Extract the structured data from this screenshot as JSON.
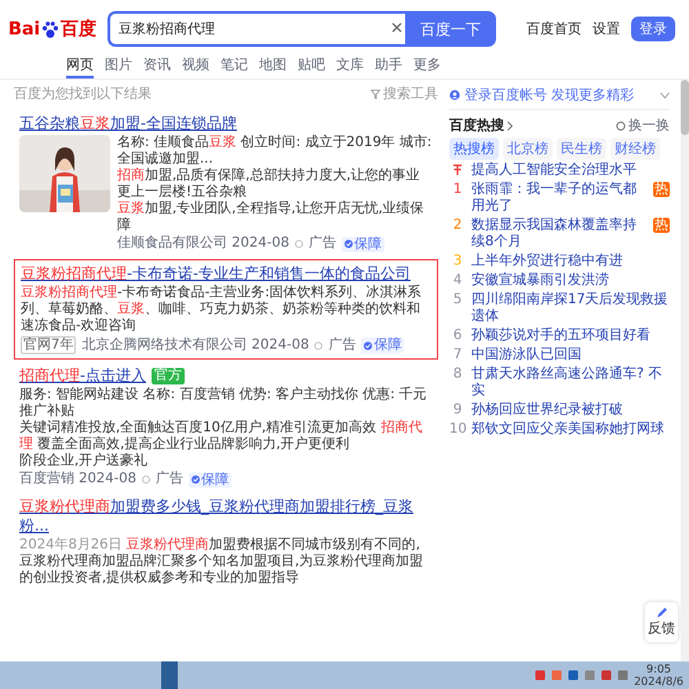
{
  "header": {
    "logo": {
      "left": "Bai",
      "right": "百度"
    },
    "search": {
      "value": "豆浆粉招商代理"
    },
    "button": "百度一下",
    "links": [
      "百度首页",
      "设置"
    ],
    "login": "登录"
  },
  "tabs": [
    {
      "label": "网页",
      "selected": true
    },
    {
      "label": "图片",
      "selected": false
    },
    {
      "label": "资讯",
      "selected": false
    },
    {
      "label": "视频",
      "selected": false
    },
    {
      "label": "笔记",
      "selected": false
    },
    {
      "label": "地图",
      "selected": false
    },
    {
      "label": "贴吧",
      "selected": false
    },
    {
      "label": "文库",
      "selected": false
    },
    {
      "label": "助手",
      "selected": false
    },
    {
      "label": "更多",
      "selected": false
    }
  ],
  "result_info": "百度为您找到以下结果",
  "tools": "搜索工具",
  "results": [
    {
      "kind": "ad",
      "framed": false,
      "picture": true,
      "title": [
        {
          "text": "五谷杂粮",
          "hit": false
        },
        {
          "text": "豆浆",
          "hit": true
        },
        {
          "text": "加盟-全国连锁品牌",
          "hit": false
        }
      ],
      "lines": [
        [
          {
            "text": "名称: 佳顺食品",
            "hit": false
          },
          {
            "text": "豆浆",
            "hit": true
          },
          {
            "text": "  创立时间: 成立于2019年  城市: 全国诚邀加盟...",
            "hit": false
          }
        ],
        [
          {
            "text": "招商",
            "hit": true
          },
          {
            "text": "加盟,品质有保障,总部扶持力度大,让您的事业更上一层楼!五谷杂粮",
            "hit": false
          }
        ],
        [
          {
            "text": "豆浆",
            "hit": true
          },
          {
            "text": "加盟,专业团队,全程指导,让您开店无忧,业绩保障",
            "hit": false
          }
        ]
      ],
      "footer": {
        "source": "佳顺食品有限公司 2024-08",
        "ad": "广告",
        "badge": "保障"
      }
    },
    {
      "kind": "ad",
      "framed": true,
      "picture": false,
      "title": [
        {
          "text": "豆浆粉招商代理",
          "hit": true
        },
        {
          "text": "-卡布奇诺-专业生产和销售一体的食品公司",
          "hit": false
        }
      ],
      "lines": [
        [
          {
            "text": "豆浆粉招商代理",
            "hit": true
          },
          {
            "text": "-卡布奇诺食品-主营业务:固体饮料系列、冰淇淋系列、草莓奶酪、",
            "hit": false
          },
          {
            "text": "豆浆",
            "hit": true
          },
          {
            "text": "、咖啡、巧克力奶茶、奶茶粉等种类的饮料和速冻食品-欢迎咨询",
            "hit": false
          }
        ]
      ],
      "footer": {
        "tag": "官网7年",
        "source": "北京企腾网络技术有限公司 2024-08",
        "ad": "广告",
        "badge": "保障"
      }
    },
    {
      "kind": "ad",
      "framed": false,
      "picture": false,
      "title": [
        {
          "text": "招商代理",
          "hit": true
        },
        {
          "text": "-点击进入",
          "hit": false
        }
      ],
      "official": "官方",
      "lines": [
        [
          {
            "text": "服务: 智能网站建设  名称: 百度营销  优势: 客户主动找你  优惠: 千元推广补贴",
            "hit": false
          }
        ],
        [
          {
            "text": "关键词精准投放,全面触达百度10亿用户,精准引流更加高效 ",
            "hit": false
          },
          {
            "text": "招商代理",
            "hit": true
          },
          {
            "text": " 覆盖全面高效,提高企业行业品牌影响力,开户更便利",
            "hit": false
          }
        ],
        [
          {
            "text": "阶段企业,开户送豪礼",
            "hit": false
          }
        ]
      ],
      "footer": {
        "source": "百度营销 2024-08",
        "ad": "广告",
        "badge": "保障"
      }
    },
    {
      "kind": "organic",
      "framed": false,
      "picture": false,
      "title": [
        {
          "text": "豆浆粉代理商",
          "hit": true
        },
        {
          "text": "加盟费多少钱_豆浆粉代理商加盟排行榜_豆浆粉...",
          "hit": false
        }
      ],
      "date": "2024年8月26日",
      "lines": [
        [
          {
            "text": "豆浆粉代理商",
            "hit": true
          },
          {
            "text": "加盟费根据不同城市级别有不同的, 豆浆粉代理商加盟品牌汇聚多个知名加盟项目,为豆浆粉代理商加盟的创业投资者,提供权威参考和专业的加盟指导",
            "hit": false
          }
        ]
      ]
    }
  ],
  "side": {
    "login_prompt": "登录百度帐号 发现更多精彩",
    "hot_title": "百度热搜",
    "refresh": "换一换",
    "tabs": [
      {
        "label": "热搜榜",
        "selected": true
      },
      {
        "label": "北京榜",
        "selected": false
      },
      {
        "label": "民生榜",
        "selected": false
      },
      {
        "label": "财经榜",
        "selected": false
      }
    ],
    "items": [
      {
        "kind": "pinned",
        "text": "提高人工智能安全治理水平",
        "color": "#f53f3f"
      },
      {
        "kind": "ranked",
        "rank": "1",
        "text": "张雨霏：我一辈子的运气都用光了",
        "badge": "热",
        "color": "#f53f3f"
      },
      {
        "kind": "ranked",
        "rank": "2",
        "text": "数据显示我国森林覆盖率持续8个月",
        "badge": "热",
        "color": "#ff8200"
      },
      {
        "kind": "ranked",
        "rank": "3",
        "text": "上半年外贸进行稳中有进",
        "color": "#ffb000"
      },
      {
        "kind": "ranked",
        "rank": "4",
        "text": "安徽宣城暴雨引发洪涝",
        "color": "#9195a3"
      },
      {
        "kind": "ranked",
        "rank": "5",
        "text": "四川绵阳南岸探17天后发现救援遗体",
        "color": "#9195a3"
      },
      {
        "kind": "ranked",
        "rank": "6",
        "text": "孙颖莎说对手的五环项目好看",
        "color": "#9195a3"
      },
      {
        "kind": "ranked",
        "rank": "7",
        "text": "中国游泳队已回国",
        "color": "#9195a3"
      },
      {
        "kind": "ranked",
        "rank": "8",
        "text": "甘肃天水路丝高速公路通车? 不实",
        "color": "#9195a3"
      },
      {
        "kind": "ranked",
        "rank": "9",
        "text": "孙杨回应世界纪录被打破",
        "color": "#9195a3"
      },
      {
        "kind": "ranked",
        "rank": "10",
        "text": "郑钦文回应父亲美国称她打网球",
        "color": "#9195a3"
      }
    ]
  },
  "feedback": "反馈",
  "taskbar": {
    "time": "9:05",
    "date": "2024/8/6"
  }
}
